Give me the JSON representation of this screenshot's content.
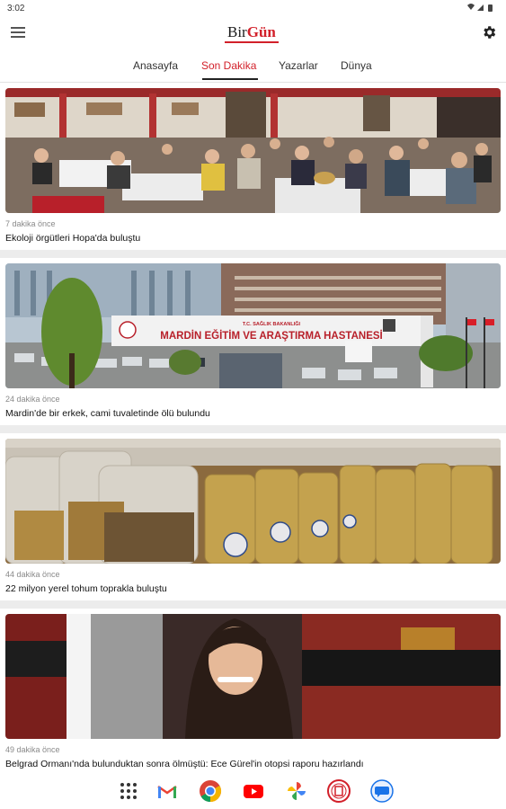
{
  "status": {
    "time": "3:02"
  },
  "header": {
    "logo_part1": "Bir",
    "logo_part2": "Gün"
  },
  "tabs": [
    {
      "label": "Anasayfa"
    },
    {
      "label": "Son Dakika"
    },
    {
      "label": "Yazarlar"
    },
    {
      "label": "Dünya"
    }
  ],
  "active_tab": "Son Dakika",
  "feed": [
    {
      "time": "7 dakika önce",
      "title": "Ekoloji örgütleri Hopa'da buluştu"
    },
    {
      "time": "24 dakika önce",
      "title": "Mardin'de bir erkek, cami tuvaletinde ölü bulundu",
      "sign_small": "T.C. SAĞLIK BAKANLIĞI",
      "sign_main": "MARDİN EĞİTİM VE ARAŞTIRMA HASTANESİ"
    },
    {
      "time": "44 dakika önce",
      "title": "22 milyon yerel tohum toprakla buluştu"
    },
    {
      "time": "49 dakika önce",
      "title": "Belgrad Ormanı'nda bulunduktan sonra ölmüştü: Ece Gürel'in otopsi raporu hazırlandı"
    }
  ],
  "dock": [
    "apps-grid-icon",
    "gmail-icon",
    "chrome-icon",
    "youtube-icon",
    "photos-icon",
    "birgun-app-icon",
    "messages-icon"
  ],
  "colors": {
    "brand": "#d2202a",
    "background": "#ececec"
  }
}
